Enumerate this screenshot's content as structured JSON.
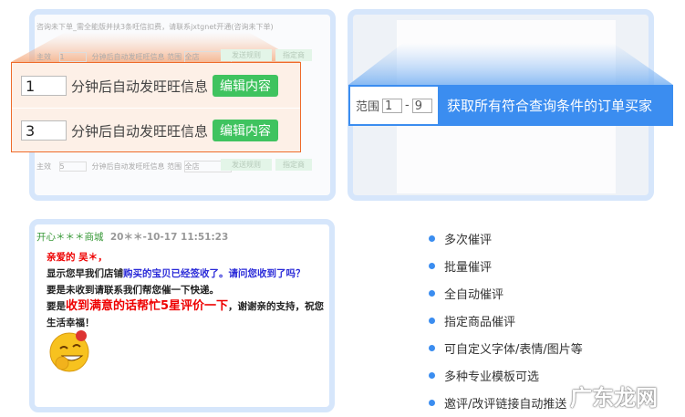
{
  "left_panel": {
    "header": "咨询未下单_需全能版并扶3条旺信扣费，请联系jxtgnet开通(咨询未下单)",
    "bg_rows": [
      {
        "check": "主效",
        "value": "1",
        "text": "分钟后自动发旺旺信息 范围",
        "select": "全店",
        "btn1": "发送规则",
        "btn2": "指定商"
      },
      {
        "check": "主效",
        "value": "5",
        "text": "分钟后自动发旺旺信息 范围",
        "select": "全店",
        "btn1": "发送规则",
        "btn2": "指定商"
      }
    ],
    "rows": [
      {
        "value": "1",
        "text": "分钟后自动发旺旺信息",
        "button": "编辑内容"
      },
      {
        "value": "3",
        "text": "分钟后自动发旺旺信息",
        "button": "编辑内容"
      }
    ]
  },
  "right_panel": {
    "range_label": "范围",
    "from": "1",
    "sep": "-",
    "to": "9",
    "description": "获取所有符合查询条件的订单买家"
  },
  "message": {
    "sender": "开心＊＊＊商城",
    "time": "20＊＊-10-17 11:51:23",
    "greeting": "亲爱的 吴＊，",
    "line1a": "显示您早我们店铺",
    "line1b": "购买的宝贝已经签收了。请问您收到了吗？",
    "line2": "要是未收到请联系我们帮您催一下快递。",
    "line3a": "要是",
    "line3b": "收到满意的话帮忙5星评价一下",
    "line3c": "，谢谢亲的支持，祝您生活幸福！"
  },
  "features": [
    "多次催评",
    "批量催评",
    "全自动催评",
    "指定商品催评",
    "可自定义字体/表情/图片等",
    "多种专业模板可选",
    "邀评/改评链接自动推送"
  ],
  "watermark": "广东龙网",
  "colors": {
    "accent": "#3b8df0",
    "green": "#3fc35f",
    "orange": "#ee6b2a"
  }
}
